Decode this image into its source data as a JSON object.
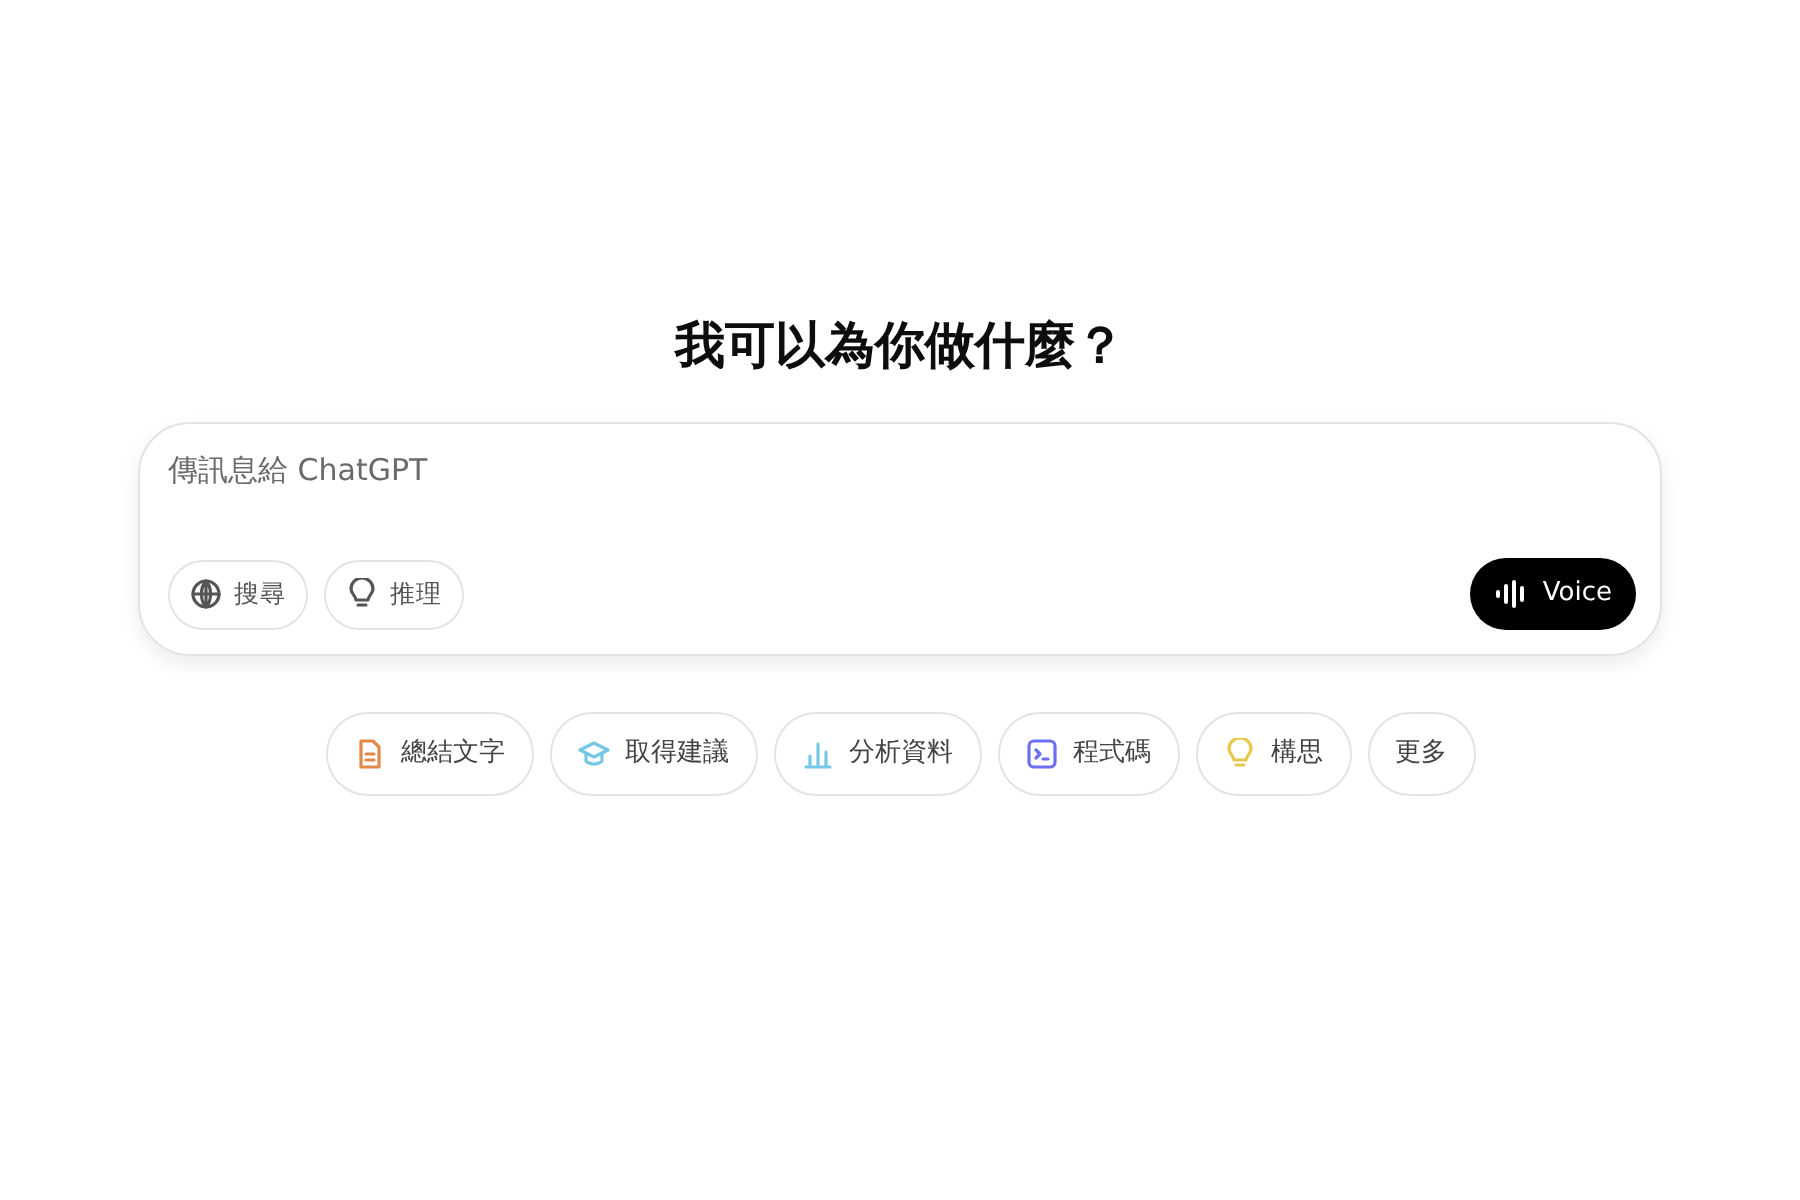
{
  "heading": "我可以為你做什麼？",
  "composer": {
    "placeholder": "傳訊息給 ChatGPT",
    "tools": [
      {
        "kind": "globe",
        "label": "搜尋"
      },
      {
        "kind": "bulb",
        "label": "推理"
      }
    ],
    "voice_button": {
      "label": "Voice"
    }
  },
  "suggestions": [
    {
      "kind": "doc",
      "label": "總結文字",
      "color": "#e2884a"
    },
    {
      "kind": "cap",
      "label": "取得建議",
      "color": "#76c6e6"
    },
    {
      "kind": "chart",
      "label": "分析資料",
      "color": "#76c6e6"
    },
    {
      "kind": "code",
      "label": "程式碼",
      "color": "#6b6ff0"
    },
    {
      "kind": "bulb",
      "label": "構思",
      "color": "#e8c84a"
    },
    {
      "kind": "none",
      "label": "更多"
    }
  ]
}
